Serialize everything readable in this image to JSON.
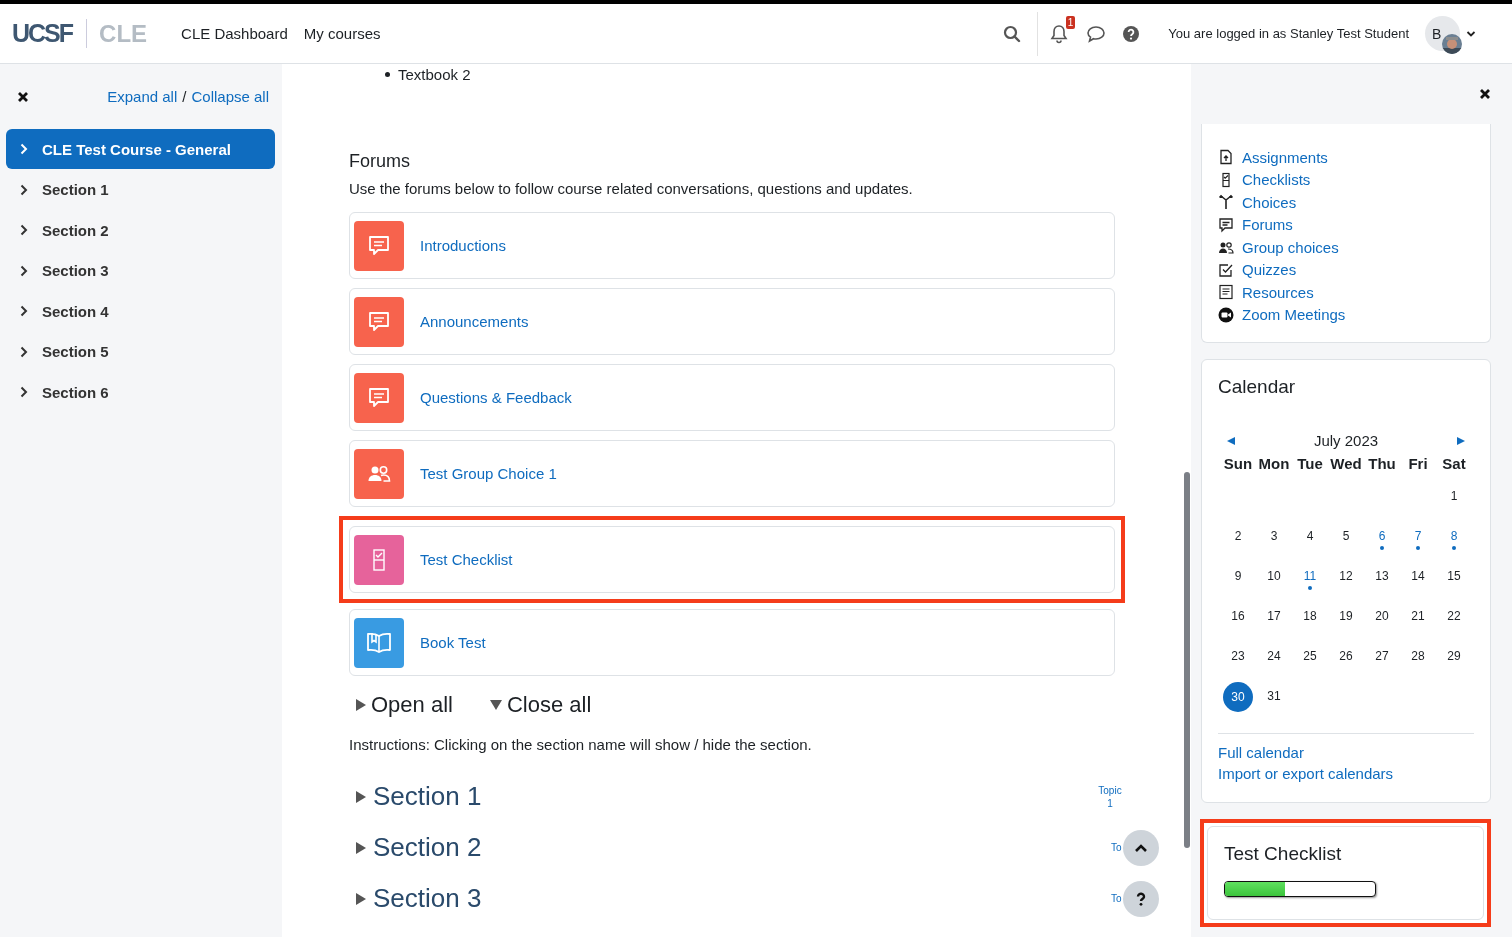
{
  "header": {
    "logo_left": "UCSF",
    "logo_right": "CLE",
    "nav": [
      "CLE Dashboard",
      "My courses"
    ],
    "notification_count": "1",
    "login_text": "You are logged in as Stanley Test Student",
    "avatar_initials": "B"
  },
  "course_index": {
    "expand_all": "Expand all",
    "separator": "/",
    "collapse_all": "Collapse all",
    "items": [
      {
        "label": "CLE Test Course - General",
        "selected": true
      },
      {
        "label": "Section 1",
        "selected": false
      },
      {
        "label": "Section 2",
        "selected": false
      },
      {
        "label": "Section 3",
        "selected": false
      },
      {
        "label": "Section 4",
        "selected": false
      },
      {
        "label": "Section 5",
        "selected": false
      },
      {
        "label": "Section 6",
        "selected": false
      }
    ]
  },
  "main": {
    "bullet": "Textbook 2",
    "forums_title": "Forums",
    "forums_intro": "Use the forums below to follow course related conversations, questions and updates.",
    "activities": [
      {
        "kind": "forum",
        "name": "Introductions",
        "highlighted": false
      },
      {
        "kind": "forum",
        "name": "Announcements",
        "highlighted": false
      },
      {
        "kind": "forum",
        "name": "Questions & Feedback",
        "highlighted": false
      },
      {
        "kind": "groupchoice",
        "name": "Test Group Choice 1",
        "highlighted": false
      },
      {
        "kind": "checklist",
        "name": "Test Checklist",
        "highlighted": true
      },
      {
        "kind": "book",
        "name": "Book Test",
        "highlighted": false
      }
    ],
    "open_all": "Open all",
    "close_all": "Close all",
    "instructions": "Instructions: Clicking on the section name will show / hide the section.",
    "sections": [
      {
        "title": "Section 1",
        "topic_word": "Topic",
        "topic_number": "1"
      },
      {
        "title": "Section 2",
        "topic_word": "To"
      },
      {
        "title": "Section 3",
        "topic_word": "To"
      }
    ]
  },
  "blocks": {
    "activities": [
      {
        "kind": "assignment",
        "label": "Assignments"
      },
      {
        "kind": "checklist",
        "label": "Checklists"
      },
      {
        "kind": "choice",
        "label": "Choices"
      },
      {
        "kind": "forum",
        "label": "Forums"
      },
      {
        "kind": "groupchoice",
        "label": "Group choices"
      },
      {
        "kind": "quiz",
        "label": "Quizzes"
      },
      {
        "kind": "resource",
        "label": "Resources"
      },
      {
        "kind": "zoom",
        "label": "Zoom Meetings"
      }
    ],
    "calendar": {
      "title": "Calendar",
      "month": "July 2023",
      "weekdays": [
        "Sun",
        "Mon",
        "Tue",
        "Wed",
        "Thu",
        "Fri",
        "Sat"
      ],
      "weeks": [
        [
          {
            "day": "1",
            "event": false,
            "today": false
          }
        ],
        [
          {
            "day": "2",
            "event": false,
            "today": false
          },
          {
            "day": "3",
            "event": false,
            "today": false
          },
          {
            "day": "4",
            "event": false,
            "today": false
          },
          {
            "day": "5",
            "event": false,
            "today": false
          },
          {
            "day": "6",
            "event": true,
            "today": false
          },
          {
            "day": "7",
            "event": true,
            "today": false
          },
          {
            "day": "8",
            "event": true,
            "today": false
          }
        ],
        [
          {
            "day": "9",
            "event": false,
            "today": false
          },
          {
            "day": "10",
            "event": false,
            "today": false
          },
          {
            "day": "11",
            "event": true,
            "today": false
          },
          {
            "day": "12",
            "event": false,
            "today": false
          },
          {
            "day": "13",
            "event": false,
            "today": false
          },
          {
            "day": "14",
            "event": false,
            "today": false
          },
          {
            "day": "15",
            "event": false,
            "today": false
          }
        ],
        [
          {
            "day": "16",
            "event": false,
            "today": false
          },
          {
            "day": "17",
            "event": false,
            "today": false
          },
          {
            "day": "18",
            "event": false,
            "today": false
          },
          {
            "day": "19",
            "event": false,
            "today": false
          },
          {
            "day": "20",
            "event": false,
            "today": false
          },
          {
            "day": "21",
            "event": false,
            "today": false
          },
          {
            "day": "22",
            "event": false,
            "today": false
          }
        ],
        [
          {
            "day": "23",
            "event": false,
            "today": false
          },
          {
            "day": "24",
            "event": false,
            "today": false
          },
          {
            "day": "25",
            "event": false,
            "today": false
          },
          {
            "day": "26",
            "event": false,
            "today": false
          },
          {
            "day": "27",
            "event": false,
            "today": false
          },
          {
            "day": "28",
            "event": false,
            "today": false
          },
          {
            "day": "29",
            "event": false,
            "today": false
          }
        ],
        [
          {
            "day": "30",
            "event": false,
            "today": true
          },
          {
            "day": "31",
            "event": false,
            "today": false
          }
        ]
      ],
      "links": [
        "Full calendar",
        "Import or export calendars"
      ]
    },
    "checklist": {
      "title": "Test Checklist",
      "level": 0.4,
      "highlighted": true
    }
  }
}
